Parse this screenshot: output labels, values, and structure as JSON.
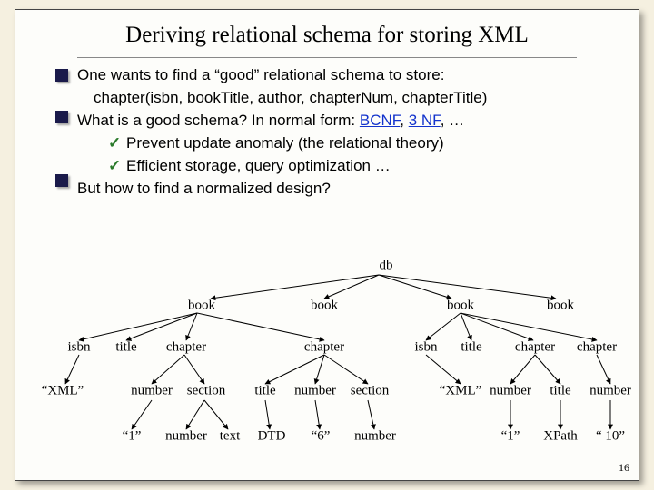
{
  "title": "Deriving relational schema for storing XML",
  "bullets": {
    "l1": "One wants to find a “good” relational schema to store:",
    "l2": "chapter(isbn, bookTitle, author, chapterNum, chapterTitle)",
    "l3a": "What is a good schema? In normal form: ",
    "bcnf": "BCNF",
    "sep": ", ",
    "tnf": "3 NF",
    "l3b": ", …",
    "l4": "Prevent update anomaly (the relational theory)",
    "l5": "Efficient storage, query optimization …",
    "l6": "But how to find a normalized design?"
  },
  "tree": {
    "db": "db",
    "book": "book",
    "isbn": "isbn",
    "title": "title",
    "chapter": "chapter",
    "xml": "“XML”",
    "number": "number",
    "section": "section",
    "one": "“1”",
    "text": "text",
    "dtd": "DTD",
    "six": "“6”",
    "xpath": "XPath",
    "ten": "“ 10”"
  },
  "page": "16",
  "check": "✓"
}
